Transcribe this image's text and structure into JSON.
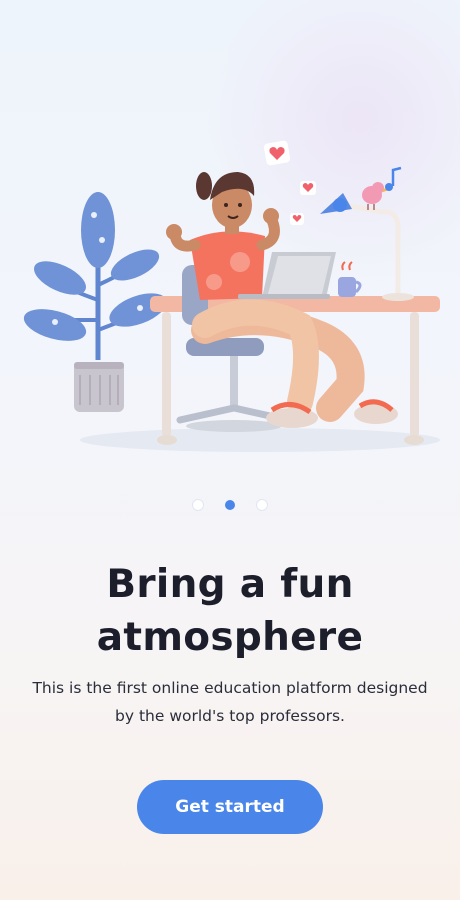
{
  "onboarding": {
    "title": "Bring a fun atmosphere",
    "subtitle": "This is the first online education platform designed by the world's top professors.",
    "cta_label": "Get started",
    "pager": {
      "total": 3,
      "active_index": 1
    }
  },
  "colors": {
    "accent": "#4a86ea",
    "title_text": "#1c1e2c",
    "body_text": "#2b2d3a",
    "shirt": "#f4735f",
    "desk_top": "#f2b8a4",
    "plant": "#6f93d6"
  },
  "icons": [
    "heart-icon",
    "music-note-icon"
  ]
}
